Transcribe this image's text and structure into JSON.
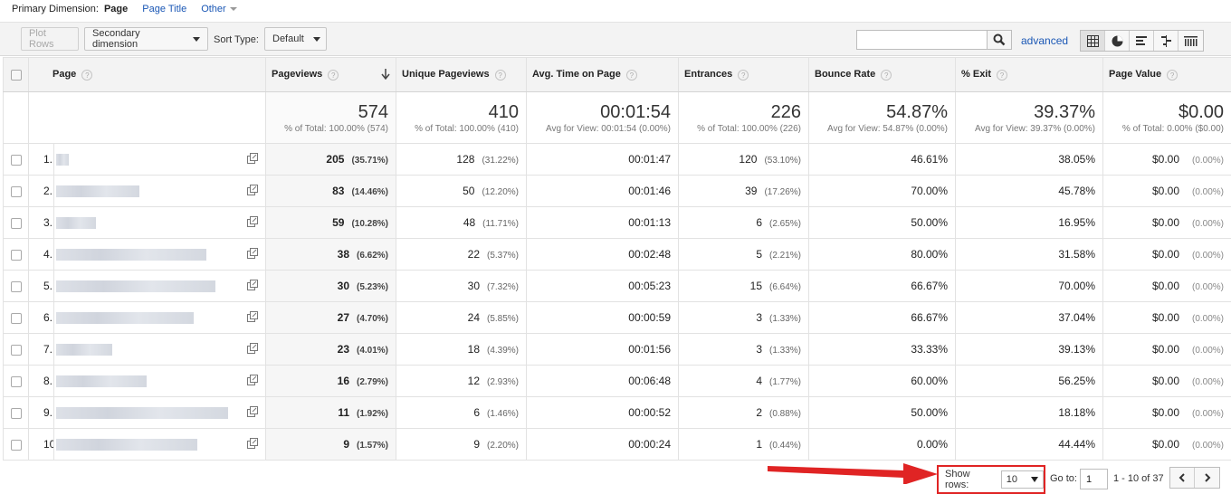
{
  "primary_dimension": {
    "label": "Primary Dimension:",
    "active": "Page",
    "options": [
      "Page Title",
      "Other"
    ]
  },
  "toolbar": {
    "plot_rows": "Plot Rows",
    "secondary_dimension": "Secondary dimension",
    "sort_type_label": "Sort Type:",
    "sort_type_value": "Default",
    "search_value": "",
    "advanced": "advanced"
  },
  "table": {
    "columns": {
      "page": "Page",
      "pageviews": "Pageviews",
      "unique_pageviews": "Unique Pageviews",
      "avg_time": "Avg. Time on Page",
      "entrances": "Entrances",
      "bounce_rate": "Bounce Rate",
      "exit": "% Exit",
      "page_value": "Page Value"
    },
    "totals": {
      "pageviews": "574",
      "pageviews_sub": "% of Total: 100.00% (574)",
      "unique_pageviews": "410",
      "unique_pageviews_sub": "% of Total: 100.00% (410)",
      "avg_time": "00:01:54",
      "avg_time_sub": "Avg for View: 00:01:54 (0.00%)",
      "entrances": "226",
      "entrances_sub": "% of Total: 100.00% (226)",
      "bounce_rate": "54.87%",
      "bounce_rate_sub": "Avg for View: 54.87% (0.00%)",
      "exit": "39.37%",
      "exit_sub": "Avg for View: 39.37% (0.00%)",
      "page_value": "$0.00",
      "page_value_sub": "% of Total: 0.00% ($0.00)"
    },
    "rows": [
      {
        "num": "1.",
        "pv": "205",
        "pv_pct": "(35.71%)",
        "upv": "128",
        "upv_pct": "(31.22%)",
        "time": "00:01:47",
        "ent": "120",
        "ent_pct": "(53.10%)",
        "bounce": "46.61%",
        "exit": "38.05%",
        "value": "$0.00",
        "value_pct": "(0.00%)"
      },
      {
        "num": "2.",
        "pv": "83",
        "pv_pct": "(14.46%)",
        "upv": "50",
        "upv_pct": "(12.20%)",
        "time": "00:01:46",
        "ent": "39",
        "ent_pct": "(17.26%)",
        "bounce": "70.00%",
        "exit": "45.78%",
        "value": "$0.00",
        "value_pct": "(0.00%)"
      },
      {
        "num": "3.",
        "pv": "59",
        "pv_pct": "(10.28%)",
        "upv": "48",
        "upv_pct": "(11.71%)",
        "time": "00:01:13",
        "ent": "6",
        "ent_pct": "(2.65%)",
        "bounce": "50.00%",
        "exit": "16.95%",
        "value": "$0.00",
        "value_pct": "(0.00%)"
      },
      {
        "num": "4.",
        "pv": "38",
        "pv_pct": "(6.62%)",
        "upv": "22",
        "upv_pct": "(5.37%)",
        "time": "00:02:48",
        "ent": "5",
        "ent_pct": "(2.21%)",
        "bounce": "80.00%",
        "exit": "31.58%",
        "value": "$0.00",
        "value_pct": "(0.00%)"
      },
      {
        "num": "5.",
        "pv": "30",
        "pv_pct": "(5.23%)",
        "upv": "30",
        "upv_pct": "(7.32%)",
        "time": "00:05:23",
        "ent": "15",
        "ent_pct": "(6.64%)",
        "bounce": "66.67%",
        "exit": "70.00%",
        "value": "$0.00",
        "value_pct": "(0.00%)"
      },
      {
        "num": "6.",
        "pv": "27",
        "pv_pct": "(4.70%)",
        "upv": "24",
        "upv_pct": "(5.85%)",
        "time": "00:00:59",
        "ent": "3",
        "ent_pct": "(1.33%)",
        "bounce": "66.67%",
        "exit": "37.04%",
        "value": "$0.00",
        "value_pct": "(0.00%)"
      },
      {
        "num": "7.",
        "pv": "23",
        "pv_pct": "(4.01%)",
        "upv": "18",
        "upv_pct": "(4.39%)",
        "time": "00:01:56",
        "ent": "3",
        "ent_pct": "(1.33%)",
        "bounce": "33.33%",
        "exit": "39.13%",
        "value": "$0.00",
        "value_pct": "(0.00%)"
      },
      {
        "num": "8.",
        "pv": "16",
        "pv_pct": "(2.79%)",
        "upv": "12",
        "upv_pct": "(2.93%)",
        "time": "00:06:48",
        "ent": "4",
        "ent_pct": "(1.77%)",
        "bounce": "60.00%",
        "exit": "56.25%",
        "value": "$0.00",
        "value_pct": "(0.00%)"
      },
      {
        "num": "9.",
        "pv": "11",
        "pv_pct": "(1.92%)",
        "upv": "6",
        "upv_pct": "(1.46%)",
        "time": "00:00:52",
        "ent": "2",
        "ent_pct": "(0.88%)",
        "bounce": "50.00%",
        "exit": "18.18%",
        "value": "$0.00",
        "value_pct": "(0.00%)"
      },
      {
        "num": "10.",
        "pv": "9",
        "pv_pct": "(1.57%)",
        "upv": "9",
        "upv_pct": "(2.20%)",
        "time": "00:00:24",
        "ent": "1",
        "ent_pct": "(0.44%)",
        "bounce": "0.00%",
        "exit": "44.44%",
        "value": "$0.00",
        "value_pct": "(0.00%)"
      }
    ]
  },
  "pagination": {
    "show_rows_label": "Show rows:",
    "show_rows_value": "10",
    "goto_label": "Go to:",
    "goto_value": "1",
    "range": "1 - 10 of 37"
  },
  "colors": {
    "link": "#1a57b5",
    "highlight": "#e02424"
  }
}
